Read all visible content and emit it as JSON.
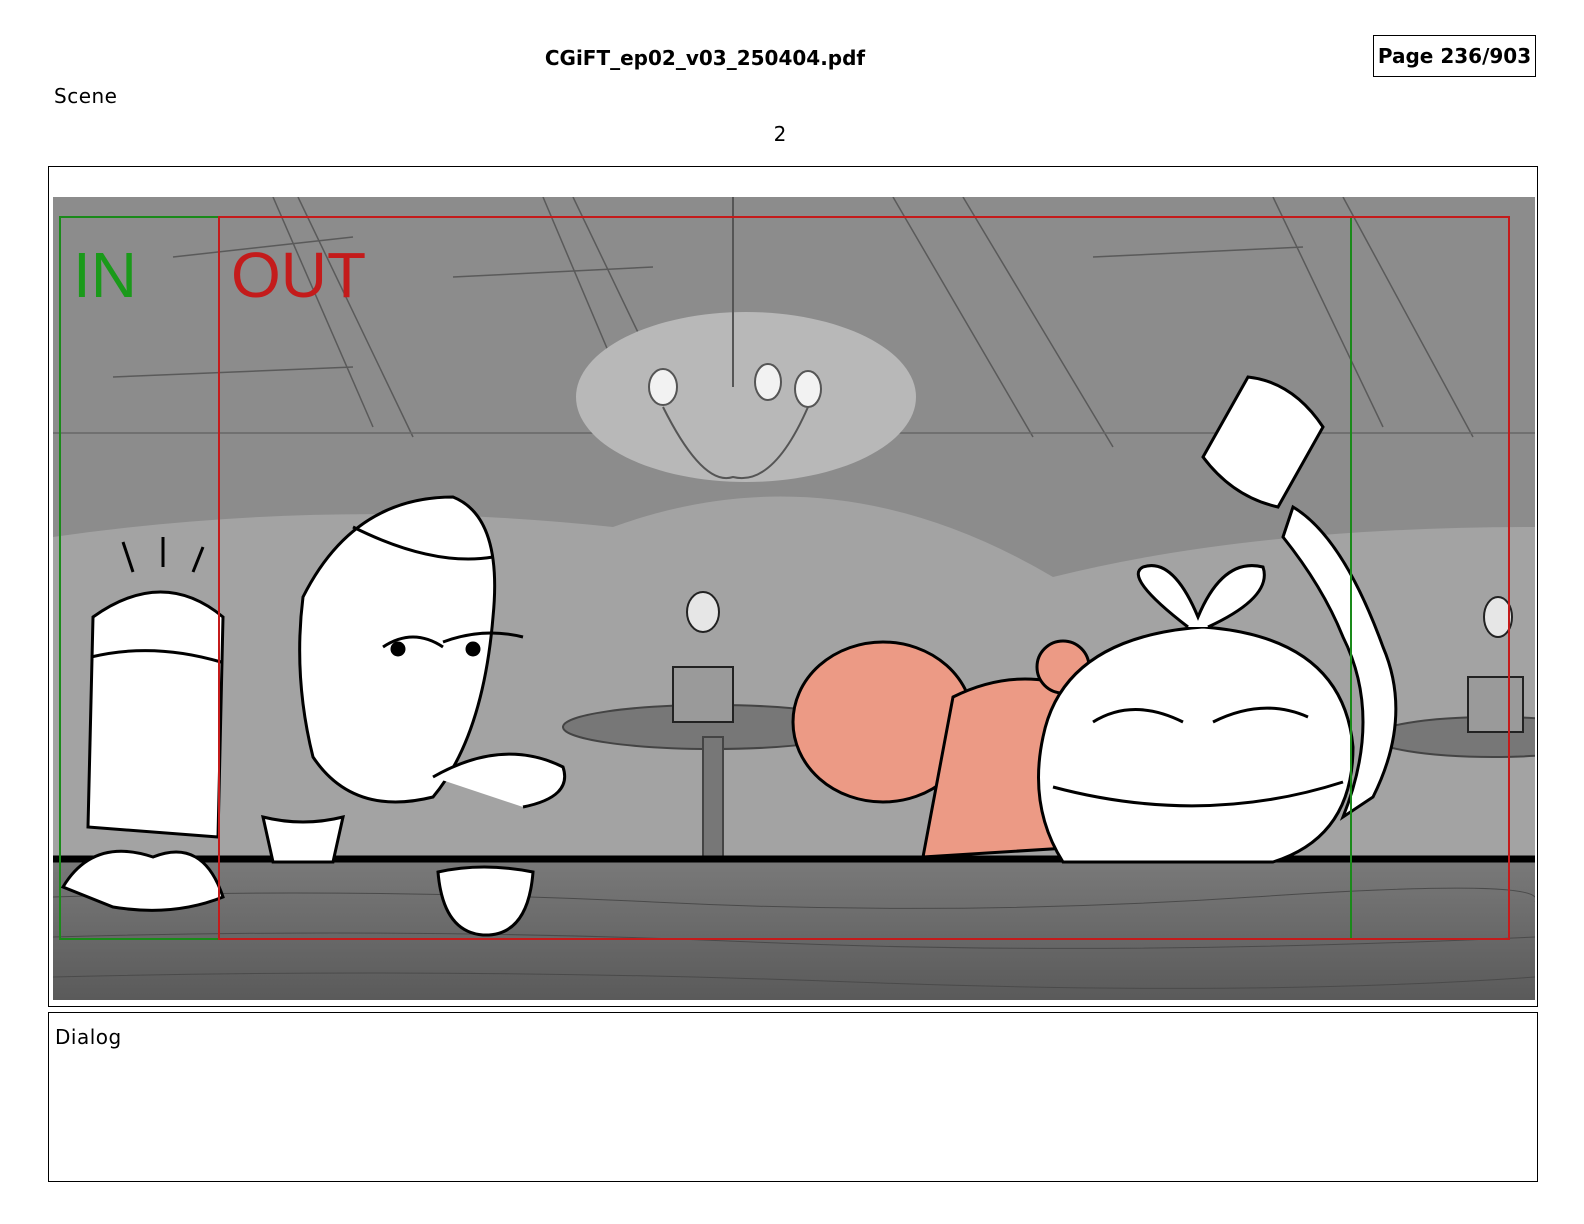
{
  "header": {
    "file_title": "CGiFT_ep02_v03_250404.pdf",
    "page_indicator": "Page 236/903"
  },
  "scene": {
    "label": "Scene",
    "number": "2"
  },
  "panel": {
    "in_marker": "IN",
    "out_marker": "OUT",
    "colors": {
      "in_frame": "#1a8a1a",
      "out_frame": "#c41b1b",
      "sky": "#8a8a8a",
      "table": "#6e6e6e",
      "pink_character": "#ec9a85"
    }
  },
  "dialog": {
    "label": "Dialog",
    "text": ""
  }
}
